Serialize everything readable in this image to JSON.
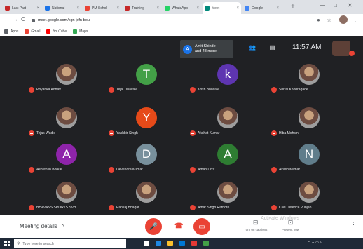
{
  "browser": {
    "tabs": [
      {
        "label": "Last Part",
        "color": "#c62828"
      },
      {
        "label": "National",
        "color": "#1a73e8"
      },
      {
        "label": "PM Schol",
        "color": "#ea4335"
      },
      {
        "label": "Training",
        "color": "#c62828"
      },
      {
        "label": "WhatsApp",
        "color": "#25d366"
      },
      {
        "label": "Meet",
        "color": "#00897b"
      },
      {
        "label": "Google",
        "color": "#4285f4"
      }
    ],
    "new_tab": "+",
    "window_controls": [
      "—",
      "□",
      "✕"
    ],
    "url": "meet.google.com/xgn-jxfn-bou",
    "bookmarks": [
      {
        "label": "Apps",
        "color": "#5f6368"
      },
      {
        "label": "Gmail",
        "color": "#ea4335"
      },
      {
        "label": "YouTube",
        "color": "#ff0000"
      },
      {
        "label": "Maps",
        "color": "#34a853"
      }
    ]
  },
  "meet": {
    "presenter": {
      "name": "Amit Shinde",
      "suffix": "and 48 more",
      "initial": "A"
    },
    "clock": "11:57 AM",
    "participants": [
      {
        "name": "Priyanka Adhav",
        "initial": "",
        "color": "",
        "photo": true
      },
      {
        "name": "Tejal Dhavale",
        "initial": "T",
        "color": "#43a047",
        "photo": false
      },
      {
        "name": "Krish Bhosale",
        "initial": "k",
        "color": "#5e35b1",
        "photo": false
      },
      {
        "name": "Shruti Khobragade",
        "initial": "",
        "color": "",
        "photo": true
      },
      {
        "name": "Tejas Wadje",
        "initial": "",
        "color": "",
        "photo": true
      },
      {
        "name": "Yashbir Singh",
        "initial": "Y",
        "color": "#e64a19",
        "photo": false
      },
      {
        "name": "Akshat Kumar",
        "initial": "",
        "color": "",
        "photo": true
      },
      {
        "name": "Hiba Mohsin",
        "initial": "",
        "color": "",
        "photo": true
      },
      {
        "name": "Ashutosh Borkar",
        "initial": "A",
        "color": "#8e24aa",
        "photo": false
      },
      {
        "name": "Devendra Kumar",
        "initial": "D",
        "color": "#78909c",
        "photo": false
      },
      {
        "name": "Aman Dixit",
        "initial": "A",
        "color": "#2e7d32",
        "photo": false
      },
      {
        "name": "Akash Kumar",
        "initial": "N",
        "color": "#607d8b",
        "photo": false
      },
      {
        "name": "BHAVANS SPORTS SVB",
        "initial": "",
        "color": "",
        "photo": true
      },
      {
        "name": "Pankaj Bhagat",
        "initial": "",
        "color": "",
        "photo": true
      },
      {
        "name": "Amar Singh Rathore",
        "initial": "",
        "color": "",
        "photo": true
      },
      {
        "name": "Civil Defence Punjab",
        "initial": "",
        "color": "",
        "photo": true
      }
    ]
  },
  "controls": {
    "meeting_details": "Meeting details",
    "captions_label": "Turn on captions",
    "present_label": "Present now",
    "watermark": "Activate Windows"
  },
  "taskbar": {
    "search_placeholder": "Type here to search"
  },
  "colors": {
    "meet_bg": "#202124",
    "accent_red": "#ea4335",
    "accent_blue": "#1a73e8"
  }
}
